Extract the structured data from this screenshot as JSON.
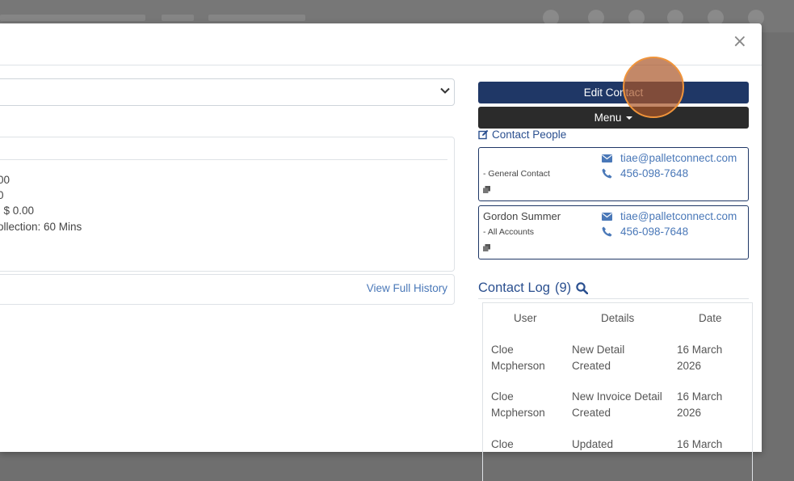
{
  "modal": {
    "close_symbol": "×"
  },
  "details": {
    "lines": [
      "00",
      "0",
      ": $ 0.00",
      "ollection: 60 Mins"
    ],
    "history_link": "View Full History"
  },
  "sidebar": {
    "edit_contact": "Edit Contact",
    "menu": "Menu",
    "contact_people": "Contact People",
    "contacts": [
      {
        "name": "",
        "role": "- General Contact",
        "email": "tiae@palletconnect.com",
        "phone": "456-098-7648"
      },
      {
        "name": "Gordon Summer",
        "role": "- All Accounts",
        "email": "tiae@palletconnect.com",
        "phone": "456-098-7648"
      }
    ]
  },
  "contact_log": {
    "title": "Contact Log",
    "count": "(9)",
    "headers": {
      "user": "User",
      "details": "Details",
      "date": "Date"
    },
    "rows": [
      {
        "user1": "Cloe",
        "user2": "Mcpherson",
        "details1": "New Detail",
        "details2": "Created",
        "date1": "16 March",
        "date2": "2026"
      },
      {
        "user1": "Cloe",
        "user2": "Mcpherson",
        "details1": "New Invoice Detail",
        "details2": "Created",
        "date1": "16 March",
        "date2": "2026"
      },
      {
        "user1": "Cloe",
        "user2": "",
        "details1": "Updated",
        "details2": "",
        "date1": "16 March",
        "date2": ""
      }
    ]
  },
  "colors": {
    "primary": "#1f3766",
    "dark": "#2b2b2b",
    "link": "#4a78b8",
    "accent_cursor": "#f0943a"
  },
  "icons": [
    "close-icon",
    "chevron-down-icon",
    "edit-icon",
    "envelope-icon",
    "phone-icon",
    "copy-icon",
    "search-icon"
  ]
}
